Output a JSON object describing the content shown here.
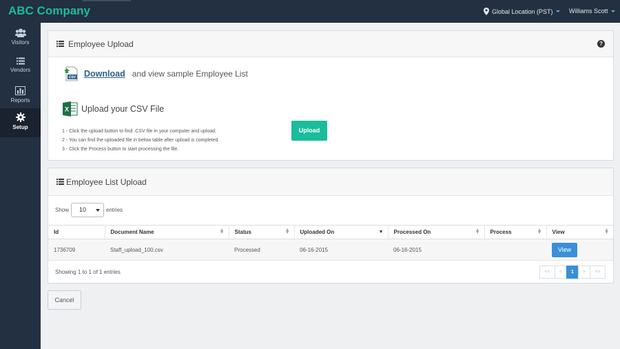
{
  "app": {
    "title": "ABC Company"
  },
  "topbar": {
    "location": "Global Location (PST)",
    "user": "Williams Scott"
  },
  "sidebar": {
    "items": [
      {
        "label": "Visitors",
        "icon": "users-icon"
      },
      {
        "label": "Vendors",
        "icon": "list-icon"
      },
      {
        "label": "Reports",
        "icon": "bar-chart-icon"
      },
      {
        "label": "Setup",
        "icon": "gear-icon",
        "active": true
      }
    ]
  },
  "upload_panel": {
    "title": "Employee Upload",
    "download_link": "Download",
    "download_text": "and view sample Employee List",
    "upload_title": "Upload your CSV File",
    "instructions": [
      "1 - Click the upload button to find .CSV file in your computer and upload.",
      "2 - You can find the uploaded file in below table after upload is completed.",
      "3 - Click the Process button to start processing the file."
    ],
    "upload_button": "Upload"
  },
  "list_panel": {
    "title": "Employee List Upload",
    "show_label": "Show",
    "entries_value": "10",
    "entries_label": "entries",
    "columns": [
      "Id",
      "Document Name",
      "Status",
      "Uploaded On",
      "Processed On",
      "Process",
      "View"
    ],
    "rows": [
      {
        "id": "1736709",
        "document": "Staff_upload_100.csv",
        "status": "Processed",
        "uploaded": "06-16-2015",
        "processed": "06-16-2015",
        "process": "",
        "view": "View"
      }
    ],
    "showing": "Showing 1 to 1 of 1 entries",
    "pager": {
      "first": "<<",
      "prev": "<",
      "current": "1",
      "next": ">",
      "last": ">>"
    }
  },
  "cancel_button": "Cancel",
  "colors": {
    "accent": "#1abc9c",
    "nav_bg": "#223041",
    "primary": "#3a8fd8"
  }
}
